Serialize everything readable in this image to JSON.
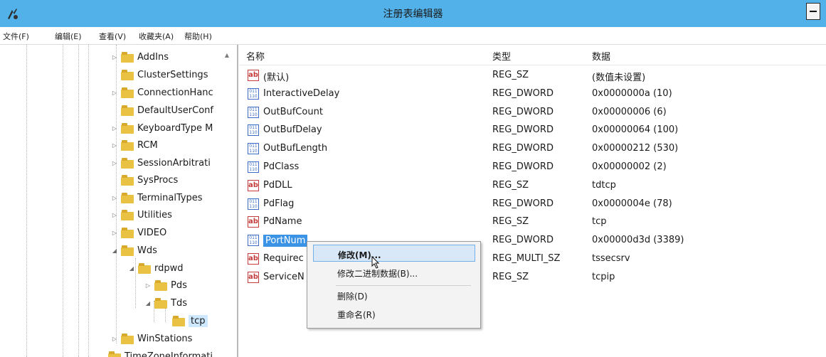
{
  "window": {
    "title": "注册表编辑器"
  },
  "menu": [
    "文件(F)",
    "编辑(E)",
    "查看(V)",
    "收藏夹(A)",
    "帮助(H)"
  ],
  "tree": [
    {
      "label": "AddIns",
      "expander": "▷"
    },
    {
      "label": "ClusterSettings",
      "expander": ""
    },
    {
      "label": "ConnectionHanc",
      "expander": "▷"
    },
    {
      "label": "DefaultUserConf",
      "expander": ""
    },
    {
      "label": "KeyboardType M",
      "expander": "▷"
    },
    {
      "label": "RCM",
      "expander": "▷"
    },
    {
      "label": "SessionArbitrati",
      "expander": "▷"
    },
    {
      "label": "SysProcs",
      "expander": ""
    },
    {
      "label": "TerminalTypes",
      "expander": "▷"
    },
    {
      "label": "Utilities",
      "expander": "▷"
    },
    {
      "label": "VIDEO",
      "expander": "▷"
    },
    {
      "label": "Wds",
      "expander": "◢"
    },
    {
      "label": "rdpwd",
      "expander": "◢"
    },
    {
      "label": "Pds",
      "expander": "▷"
    },
    {
      "label": "Tds",
      "expander": "◢"
    },
    {
      "label": "tcp",
      "expander": ""
    },
    {
      "label": "WinStations",
      "expander": "▷"
    },
    {
      "label": "TimeZoneInformati",
      "expander": ""
    }
  ],
  "list": {
    "headers": {
      "name": "名称",
      "type": "类型",
      "data": "数据"
    },
    "rows": [
      {
        "icon": "ab",
        "name": "(默认)",
        "type": "REG_SZ",
        "data": "(数值未设置)"
      },
      {
        "icon": "bin",
        "name": "InteractiveDelay",
        "type": "REG_DWORD",
        "data": "0x0000000a (10)"
      },
      {
        "icon": "bin",
        "name": "OutBufCount",
        "type": "REG_DWORD",
        "data": "0x00000006 (6)"
      },
      {
        "icon": "bin",
        "name": "OutBufDelay",
        "type": "REG_DWORD",
        "data": "0x00000064 (100)"
      },
      {
        "icon": "bin",
        "name": "OutBufLength",
        "type": "REG_DWORD",
        "data": "0x00000212 (530)"
      },
      {
        "icon": "bin",
        "name": "PdClass",
        "type": "REG_DWORD",
        "data": "0x00000002 (2)"
      },
      {
        "icon": "ab",
        "name": "PdDLL",
        "type": "REG_SZ",
        "data": "tdtcp"
      },
      {
        "icon": "bin",
        "name": "PdFlag",
        "type": "REG_DWORD",
        "data": "0x0000004e (78)"
      },
      {
        "icon": "ab",
        "name": "PdName",
        "type": "REG_SZ",
        "data": "tcp"
      },
      {
        "icon": "bin",
        "name": "PortNum",
        "type": "REG_DWORD",
        "data": "0x00000d3d (3389)"
      },
      {
        "icon": "ab",
        "name": "Requirec",
        "type": "REG_MULTI_SZ",
        "data": "tssecsrv"
      },
      {
        "icon": "ab",
        "name": "ServiceN",
        "type": "REG_SZ",
        "data": "tcpip"
      }
    ]
  },
  "context_menu": {
    "modify": "修改(M)...",
    "modify_binary": "修改二进制数据(B)...",
    "delete": "删除(D)",
    "rename": "重命名(R)"
  },
  "colors": {
    "titlebar": "#52b1e8",
    "selection": "#3b93e6"
  }
}
